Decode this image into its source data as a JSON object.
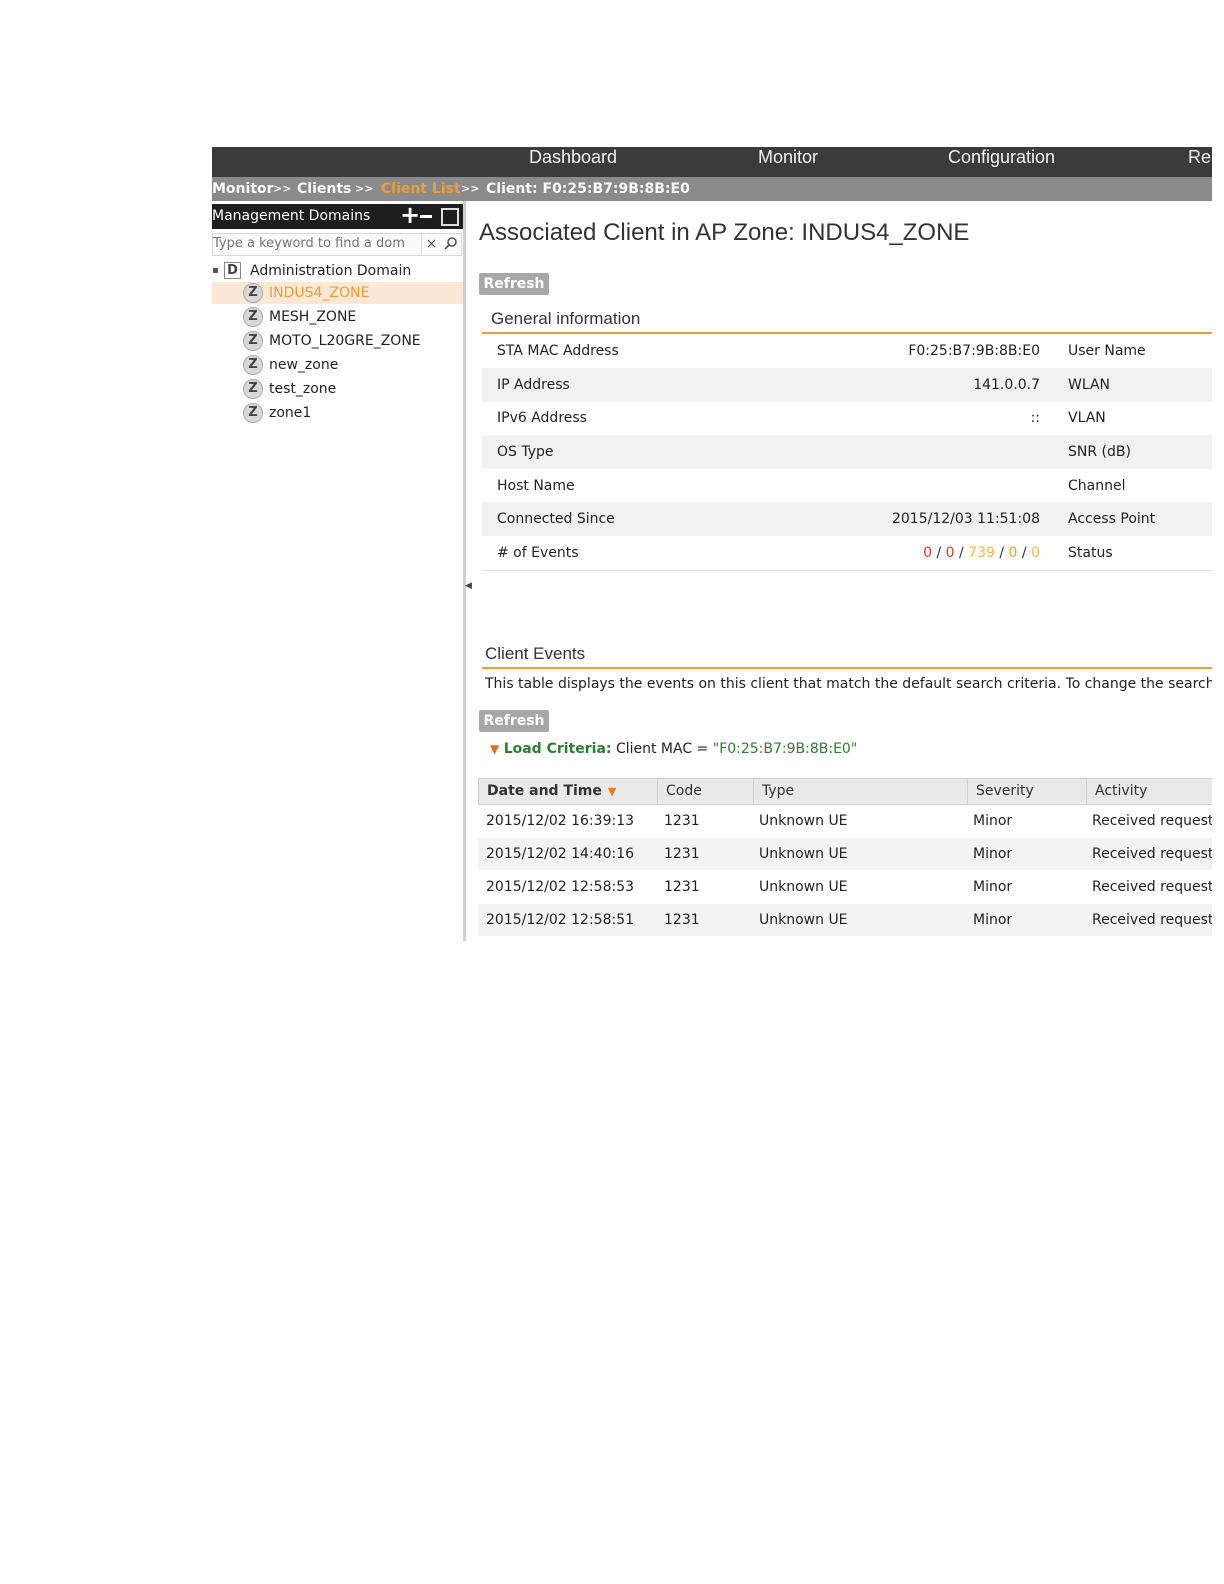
{
  "nav": {
    "items": [
      "Dashboard",
      "Monitor",
      "Configuration",
      "Re"
    ]
  },
  "breadcrumb": {
    "monitor": "Monitor",
    "sep": ">>",
    "clients": "Clients",
    "client_list": "Client List",
    "client": "Client: F0:25:B7:9B:8B:E0"
  },
  "sidebar": {
    "title": "Management Domains",
    "search_placeholder": "Type a keyword to find a dom",
    "root": {
      "icon": "D",
      "label": "Administration Domain"
    },
    "zones": [
      {
        "icon": "Z",
        "label": "INDUS4_ZONE",
        "selected": true
      },
      {
        "icon": "Z",
        "label": "MESH_ZONE"
      },
      {
        "icon": "Z",
        "label": "MOTO_L20GRE_ZONE"
      },
      {
        "icon": "Z",
        "label": "new_zone"
      },
      {
        "icon": "Z",
        "label": "test_zone"
      },
      {
        "icon": "Z",
        "label": "zone1"
      }
    ]
  },
  "main": {
    "title": "Associated Client in AP Zone: INDUS4_ZONE",
    "refresh_label": "Refresh",
    "general": {
      "title": "General information",
      "rows": [
        {
          "key": "STA MAC Address",
          "value": "F0:25:B7:9B:8B:E0",
          "key2": "User Name"
        },
        {
          "key": "IP Address",
          "value": "141.0.0.7",
          "key2": "WLAN"
        },
        {
          "key": "IPv6 Address",
          "value": "::",
          "key2": "VLAN"
        },
        {
          "key": "OS Type",
          "value": "",
          "key2": "SNR (dB)"
        },
        {
          "key": "Host Name",
          "value": "",
          "key2": "Channel"
        },
        {
          "key": "Connected Since",
          "value": "2015/12/03 11:51:08",
          "key2": "Access Point"
        },
        {
          "key": "# of Events",
          "value": "",
          "key2": "Status"
        }
      ],
      "events_counts": [
        "0",
        "0",
        "739",
        "0",
        "0"
      ],
      "events_sep": "/"
    },
    "events": {
      "title": "Client Events",
      "description": "This table displays the events on this client that match the default search criteria. To change the search c",
      "refresh_label": "Refresh",
      "criteria_label": "Load Criteria:",
      "criteria_key": "Client MAC =",
      "criteria_value": "\"F0:25:B7:9B:8B:E0\"",
      "columns": [
        "Date and Time",
        "Code",
        "Type",
        "Severity",
        "Activity"
      ],
      "rows": [
        [
          "2015/12/02 16:39:13",
          "1231",
          "Unknown UE",
          "Minor",
          "Received request"
        ],
        [
          "2015/12/02 14:40:16",
          "1231",
          "Unknown UE",
          "Minor",
          "Received request"
        ],
        [
          "2015/12/02 12:58:53",
          "1231",
          "Unknown UE",
          "Minor",
          "Received request"
        ],
        [
          "2015/12/02 12:58:51",
          "1231",
          "Unknown UE",
          "Minor",
          "Received request"
        ]
      ]
    }
  },
  "colors": {
    "accent": "#f39c34",
    "nav_bg": "#3b3b3b",
    "crumb_bg": "#8a8a8a",
    "criteria": "#2e7d32"
  }
}
